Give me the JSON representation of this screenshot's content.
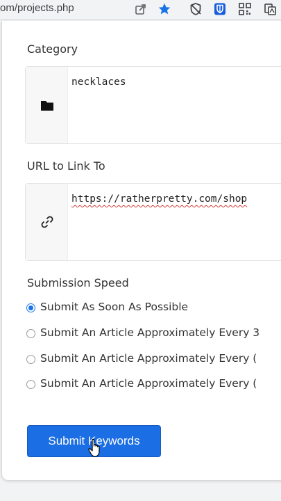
{
  "browser": {
    "url": "om/projects.php",
    "icons": [
      "share-icon",
      "star-icon",
      "shield-icon",
      "bitwarden-icon",
      "qr-code-icon",
      "extension-icon"
    ]
  },
  "form": {
    "category": {
      "label": "Category",
      "value": "necklaces",
      "icon": "folder-icon"
    },
    "url": {
      "label": "URL to Link To",
      "value": "https://ratherpretty.com/shop",
      "icon": "link-icon"
    },
    "speed": {
      "label": "Submission Speed",
      "options": [
        {
          "label": "Submit As Soon As Possible",
          "checked": true
        },
        {
          "label": "Submit An Article Approximately Every 3",
          "checked": false
        },
        {
          "label": "Submit An Article Approximately Every (",
          "checked": false
        },
        {
          "label": "Submit An Article Approximately Every (",
          "checked": false
        }
      ]
    },
    "submit_label": "Submit Keywords"
  },
  "colors": {
    "accent": "#1b6ee3",
    "star": "#1a73e8"
  }
}
